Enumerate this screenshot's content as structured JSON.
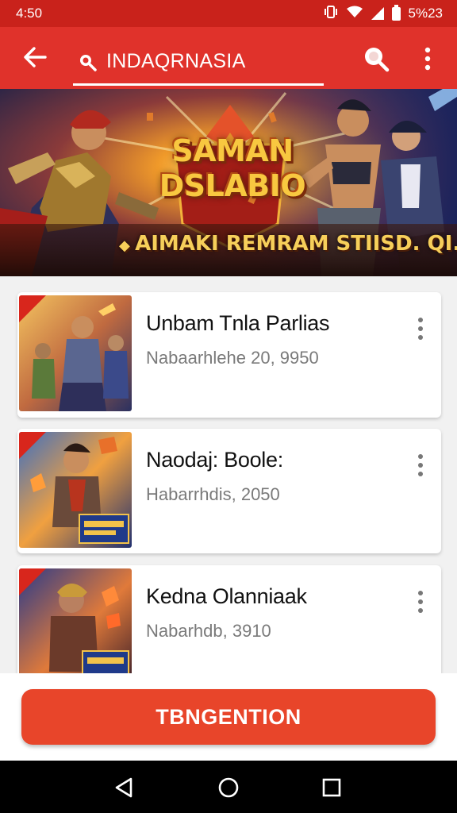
{
  "status_bar": {
    "time": "4:50",
    "battery_text": "5%23"
  },
  "app_bar": {
    "search_text": "INDAQRNASIA"
  },
  "banner": {
    "title_line1": "SAMAN",
    "title_line2": "DSLABIO",
    "subtitle": "AIMAKI REMRAM STIISD. QI.TIP"
  },
  "cards": [
    {
      "title": "Unbam Tnla Parlias",
      "subtitle": "Nabaarhlehe 20, 9950"
    },
    {
      "title": "Naodaj: Boole:",
      "subtitle": "Habarrhdis, 2050"
    },
    {
      "title": "Kedna Olanniaak",
      "subtitle": "Nabarhdb, 3910"
    }
  ],
  "cta": {
    "label": "TBNGENTION"
  },
  "colors": {
    "status_bar": "#c9221b",
    "app_bar": "#e0322b",
    "cta": "#e8452a",
    "nav_bar": "#000000"
  }
}
